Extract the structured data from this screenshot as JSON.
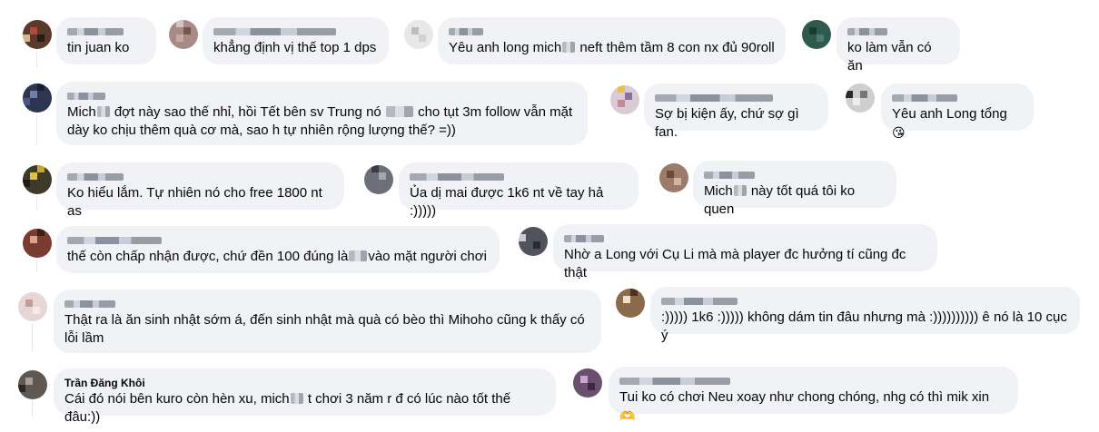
{
  "comments": [
    {
      "author": "",
      "blurred_author": true,
      "text": "tin juan ko",
      "emoji": ""
    },
    {
      "author": "",
      "blurred_author": true,
      "text": "khẳng định vị thế top 1 dps",
      "emoji": ""
    },
    {
      "author": "",
      "blurred_author": true,
      "text_before": "Yêu anh long mich",
      "text_after": " neft thêm tầm 8 con nx đủ 90roll"
    },
    {
      "author": "",
      "blurred_author": true,
      "text": "ko làm vẫn có ăn",
      "emoji": ""
    },
    {
      "author": "",
      "blurred_author": true,
      "text_before": "Mich",
      "text_mid": " đợt này sao thế nhỉ, hồi Tết bên sv Trung nó ",
      "text_after": " cho tụt 3m follow vẫn mặt dày ko chịu thêm quà cơ mà, sao h tự nhiên rộng lượng thế? =))"
    },
    {
      "author": "",
      "blurred_author": true,
      "text": "Sợ bị kiện ấy, chứ sợ gì fan.",
      "emoji": ""
    },
    {
      "author": "",
      "blurred_author": true,
      "text": "Yêu anh Long tổng ",
      "emoji": "😘"
    },
    {
      "author": "",
      "blurred_author": true,
      "text": "Ko hiểu lắm. Tự nhiên nó cho free 1800 nt as",
      "emoji": ""
    },
    {
      "author": "",
      "blurred_author": true,
      "text": "Ủa dị mai được 1k6 nt về tay hả :)))))",
      "emoji": ""
    },
    {
      "author": "",
      "blurred_author": true,
      "text_before": "Mich",
      "text_after": " này tốt quá tôi ko quen"
    },
    {
      "author": "",
      "blurred_author": true,
      "text_before": "thế còn chấp nhận được, chứ đền 100 đúng là",
      "text_after": "vào mặt người chơi"
    },
    {
      "author": "",
      "blurred_author": true,
      "text": "Nhờ a Long với Cụ Li mà mà player đc hưởng tí cũng đc thật",
      "emoji": ""
    },
    {
      "author": "",
      "blurred_author": true,
      "text": "Thật ra là ăn sinh nhật sớm á, đến sinh nhật mà quà có bèo thì Mihoho cũng k thấy có lỗi lầm",
      "emoji": ""
    },
    {
      "author": "",
      "blurred_author": true,
      "text": ":))))) 1k6 :))))) không dám tin đâu nhưng mà :)))))))))) ê nó là 10 cục ý",
      "emoji": ""
    },
    {
      "author": "Trần Đăng Khôi",
      "blurred_author": false,
      "text_before": "Cái đó nói bên kuro còn hèn xu, mich",
      "text_after": " t chơi 3 năm r đ có lúc nào tốt thế đâu:))"
    },
    {
      "author": "",
      "blurred_author": true,
      "text": "Tui ko có chơi Neu xoay như chong chóng, nhg có thì mik xin ",
      "emoji": "🫶"
    }
  ]
}
